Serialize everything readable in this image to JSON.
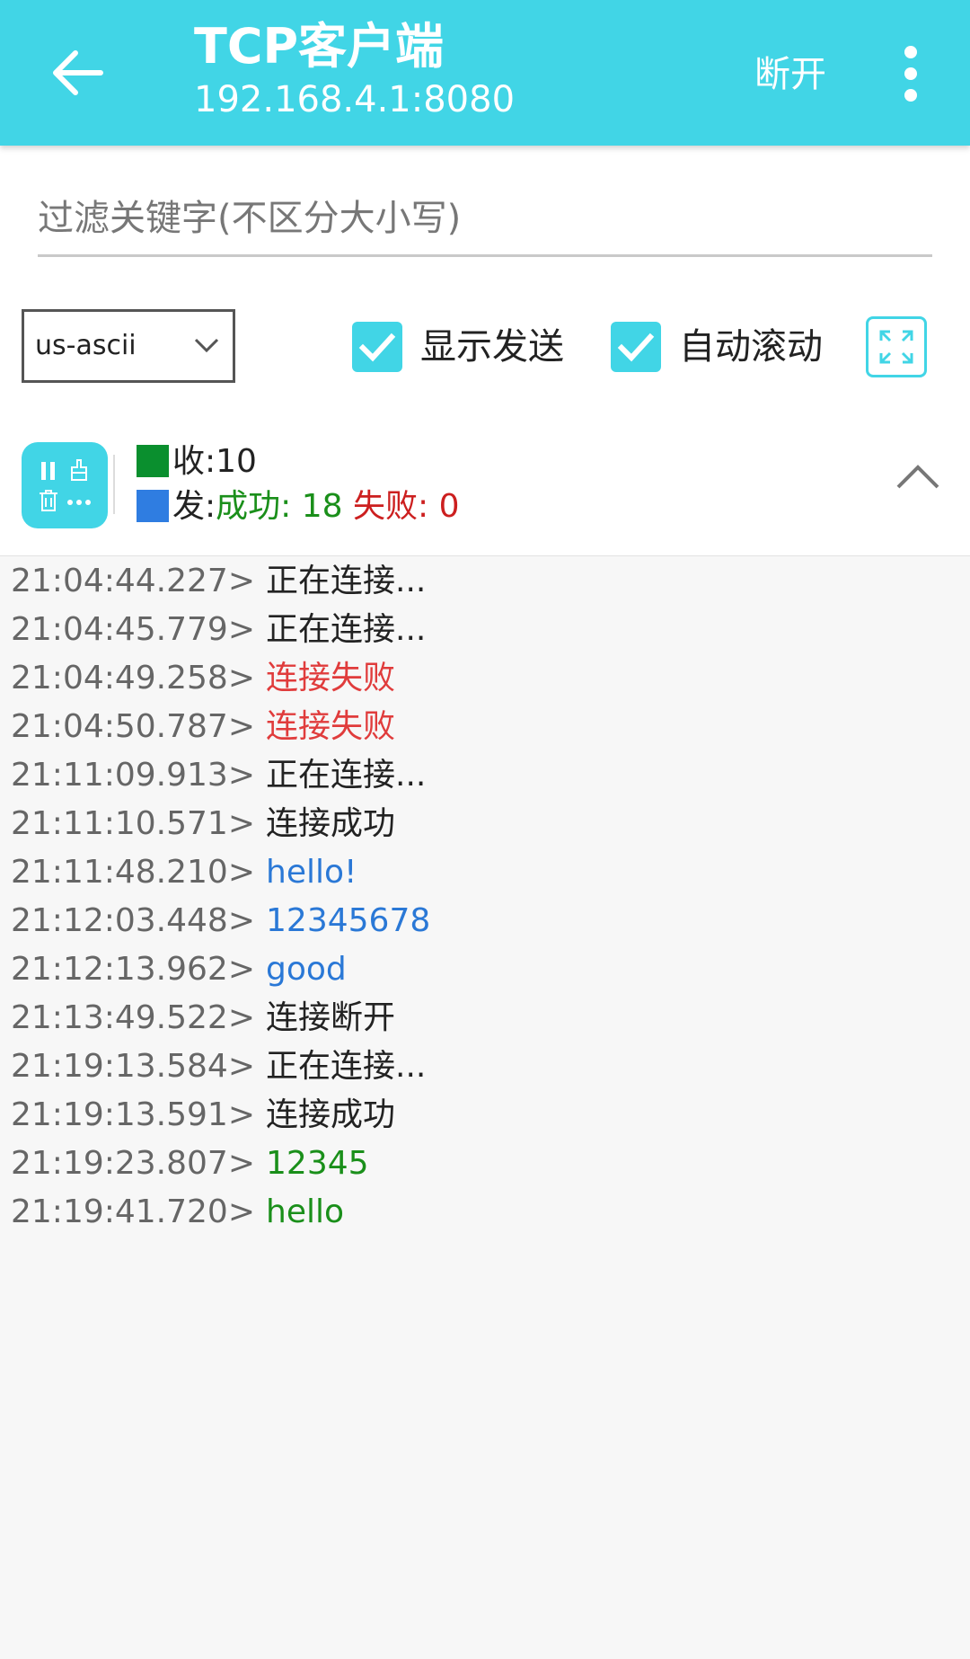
{
  "appbar": {
    "title": "TCP客户端",
    "subtitle": "192.168.4.1:8080",
    "disconnect_label": "断开",
    "color": "#41d5e6",
    "back_icon": "arrow-left-icon",
    "more_icon": "more-vertical-icon"
  },
  "filter": {
    "placeholder": "过滤关键字(不区分大小写)",
    "value": ""
  },
  "options": {
    "encoding": "us-ascii",
    "show_send": {
      "label": "显示发送",
      "checked": true
    },
    "auto_scroll": {
      "label": "自动滚动",
      "checked": true
    },
    "fullscreen_icon": "expand-icon"
  },
  "stats": {
    "recv_label": "收:",
    "recv_count": "10",
    "send_label": "发:",
    "success_label": "成功:",
    "success_count": "18",
    "fail_label": "失败:",
    "fail_count": "0",
    "recv_color": "#0a8f2e",
    "send_color": "#2f7de1",
    "tools_icons": [
      "pause-icon",
      "clear-brush-icon",
      "trash-icon",
      "more-horizontal-icon"
    ],
    "collapse_icon": "chevron-up-icon"
  },
  "log": [
    {
      "time": "21:04:44.227>",
      "text": "正在连接...",
      "kind": "status"
    },
    {
      "time": "21:04:45.779>",
      "text": "正在连接...",
      "kind": "status"
    },
    {
      "time": "21:04:49.258>",
      "text": "连接失败",
      "kind": "error"
    },
    {
      "time": "21:04:50.787>",
      "text": "连接失败",
      "kind": "error"
    },
    {
      "time": "21:11:09.913>",
      "text": "正在连接...",
      "kind": "status"
    },
    {
      "time": "21:11:10.571>",
      "text": "连接成功",
      "kind": "status"
    },
    {
      "time": "21:11:48.210>",
      "text": "hello!",
      "kind": "sent"
    },
    {
      "time": "21:12:03.448>",
      "text": "12345678",
      "kind": "sent"
    },
    {
      "time": "21:12:13.962>",
      "text": "good",
      "kind": "sent"
    },
    {
      "time": "21:13:49.522>",
      "text": "连接断开",
      "kind": "status"
    },
    {
      "time": "21:19:13.584>",
      "text": "正在连接...",
      "kind": "status"
    },
    {
      "time": "21:19:13.591>",
      "text": "连接成功",
      "kind": "status"
    },
    {
      "time": "21:19:23.807>",
      "text": "12345",
      "kind": "recv"
    },
    {
      "time": "21:19:41.720>",
      "text": "hello",
      "kind": "recv"
    }
  ]
}
